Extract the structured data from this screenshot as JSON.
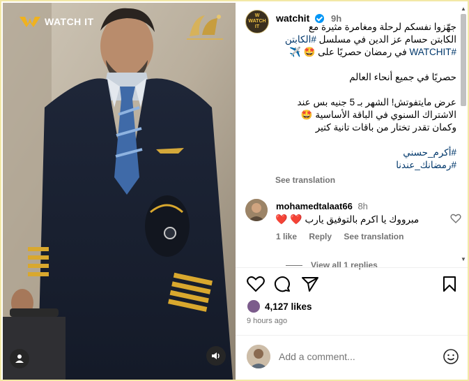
{
  "media": {
    "brand_text": "WATCH IT"
  },
  "post": {
    "username": "watchit",
    "time": "9h",
    "caption": [
      "جهّزوا نفسكم لرحلة ومغامرة مثيرة مع",
      "الكابتن حسام عز الدين في مسلسل #الكابتن",
      "#WATCHIT في رمضان حصريًا على 🤩 ✈️"
    ],
    "caption_2": "حصريًا في جميع أنحاء العالم",
    "caption_3": [
      "عرض مايتفوتش! الشهر بـ 5 جنيه بس عند",
      "الاشتراك السنوي في الباقة الأساسية 🤩",
      "وكمان تقدر تختار من باقات تانية كتير"
    ],
    "hashtags": [
      "#أكرم_حسني",
      "#رمضانك_عندنا"
    ],
    "see_translation": "See translation"
  },
  "comment": {
    "username": "mohamedtalaat66",
    "time": "8h",
    "text": "مبرووك يا اكرم بالتوفيق يارب",
    "hearts": "❤️ ❤️",
    "likes": "1 like",
    "reply": "Reply",
    "see_translation": "See translation",
    "view_replies": "View all 1 replies"
  },
  "footer": {
    "likes_count": "4,127 likes",
    "time_ago": "9 hours ago",
    "add_comment_placeholder": "Add a comment..."
  },
  "colors": {
    "link": "#00376b",
    "muted": "#737373",
    "verified": "#0095f6",
    "heart": "#e0102a"
  }
}
